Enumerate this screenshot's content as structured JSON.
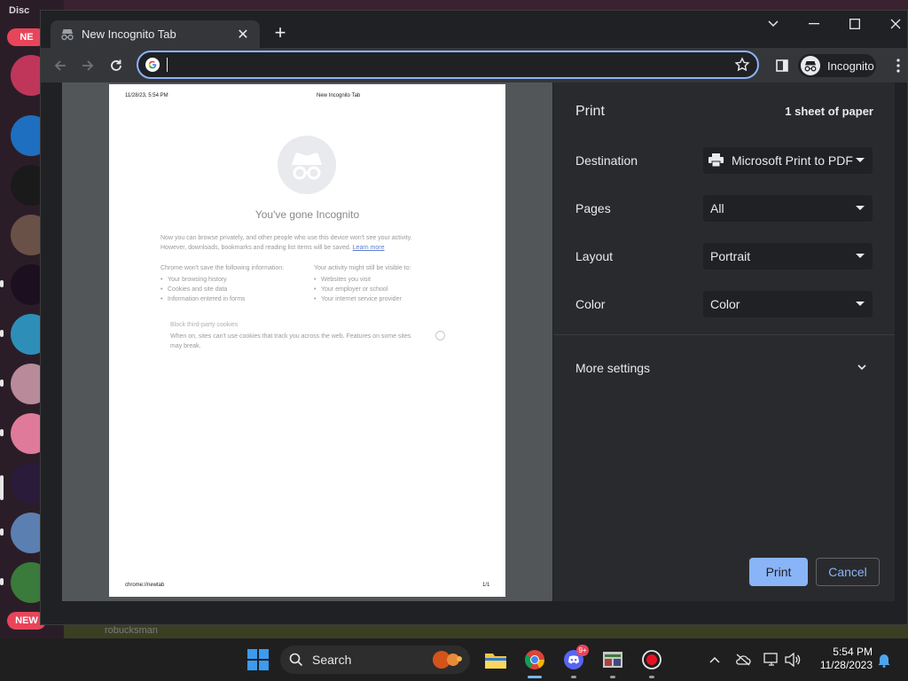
{
  "background": {
    "discord_label": "Disc",
    "pill_top": "NE",
    "pill_bottom": "NEW",
    "bottom_user": "robucksman"
  },
  "browser": {
    "tab_title": "New Incognito Tab",
    "omnibox_value": "",
    "profile_label": "Incognito"
  },
  "preview": {
    "header_date": "11/28/23, 5:54 PM",
    "header_title": "New Incognito Tab",
    "heading": "You've gone Incognito",
    "para_line1": "Now you can browse privately, and other people who use this device won't see your activity.",
    "para_line2": "However, downloads, bookmarks and reading list items will be saved.",
    "learn_more": "Learn more",
    "col1_title": "Chrome won't save the following information:",
    "col1_items": [
      "Your browsing history",
      "Cookies and site data",
      "Information entered in forms"
    ],
    "col2_title": "Your activity might still be visible to:",
    "col2_items": [
      "Websites you visit",
      "Your employer or school",
      "Your internet service provider"
    ],
    "cookie_title": "Block third-party cookies",
    "cookie_desc": "When on, sites can't use cookies that track you across the web. Features on some sites may break.",
    "footer_url": "chrome://newtab",
    "footer_page": "1/1"
  },
  "print_panel": {
    "title": "Print",
    "sheets": "1 sheet of paper",
    "destination_label": "Destination",
    "destination_value": "Microsoft Print to PDF",
    "pages_label": "Pages",
    "pages_value": "All",
    "layout_label": "Layout",
    "layout_value": "Portrait",
    "color_label": "Color",
    "color_value": "Color",
    "more_settings": "More settings",
    "print_button": "Print",
    "cancel_button": "Cancel"
  },
  "taskbar": {
    "search_label": "Search",
    "discord_badge": "9+",
    "time": "5:54 PM",
    "date": "11/28/2023"
  },
  "colors": {
    "accent": "#8ab4f8",
    "panel_bg": "#292a2d",
    "chrome_bg": "#202124",
    "toolbar_bg": "#35363a"
  }
}
